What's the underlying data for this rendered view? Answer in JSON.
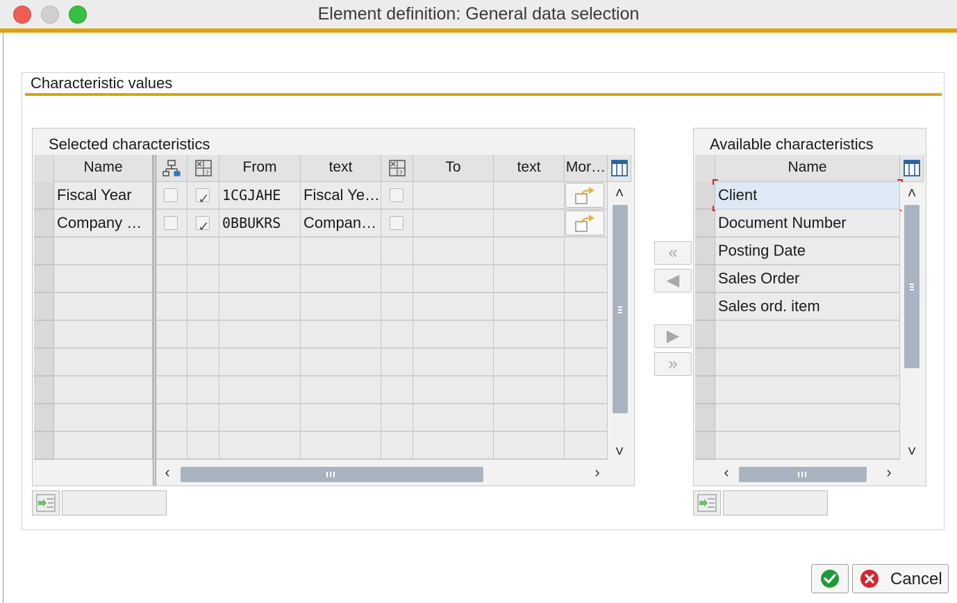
{
  "window": {
    "title": "Element definition: General data selection"
  },
  "group": {
    "title": "Characteristic values"
  },
  "selected_panel": {
    "title": "Selected characteristics",
    "columns": [
      "Name",
      "From",
      "text",
      "To",
      "text",
      "Mor…"
    ],
    "rows": [
      {
        "name": "Fiscal Year",
        "hierarchy_checked": false,
        "exclude_checked": true,
        "from": "1CGJAHE",
        "from_text": "Fiscal Ye…",
        "to_checked": false,
        "to": "",
        "to_text": ""
      },
      {
        "name": "Company C…",
        "hierarchy_checked": false,
        "exclude_checked": true,
        "from": "0BBUKRS",
        "from_text": "Company…",
        "to_checked": false,
        "to": "",
        "to_text": ""
      }
    ]
  },
  "available_panel": {
    "title": "Available characteristics",
    "column": "Name",
    "items": [
      "Client",
      "Document Number",
      "Posting Date",
      "Sales Order",
      "Sales ord. item"
    ],
    "selected_index": 0
  },
  "colors": {
    "accent": "#e0a100",
    "selected_row": "#dde9f5",
    "ok_green": "#1f9a3a",
    "cancel_red": "#d6262f"
  },
  "icons": {
    "transfer_all_left": "«",
    "transfer_left": "◀",
    "transfer_right": "▶",
    "transfer_all_right": "»",
    "scroll_up": "˄",
    "scroll_down": "˅",
    "scroll_left": "‹",
    "scroll_right": "›"
  },
  "buttons": {
    "ok": "",
    "cancel": "Cancel"
  }
}
